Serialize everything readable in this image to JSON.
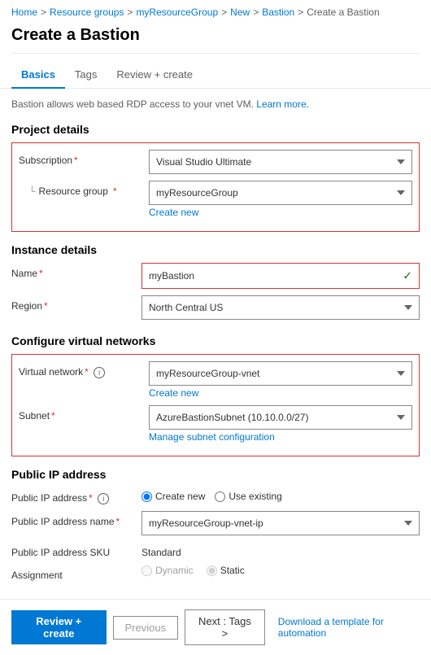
{
  "breadcrumb": {
    "items": [
      {
        "label": "Home",
        "link": true
      },
      {
        "label": "Resource groups",
        "link": true
      },
      {
        "label": "myResourceGroup",
        "link": true
      },
      {
        "label": "New",
        "link": true
      },
      {
        "label": "Bastion",
        "link": true
      },
      {
        "label": "Create a Bastion",
        "link": false
      }
    ],
    "separator": ">"
  },
  "page": {
    "title": "Create a Bastion"
  },
  "tabs": [
    {
      "label": "Basics",
      "active": true
    },
    {
      "label": "Tags",
      "active": false
    },
    {
      "label": "Review + create",
      "active": false
    }
  ],
  "info_text": "Bastion allows web based RDP access to your vnet VM.",
  "learn_more": "Learn more.",
  "sections": {
    "project_details": {
      "title": "Project details",
      "subscription": {
        "label": "Subscription",
        "required": true,
        "value": "Visual Studio Ultimate"
      },
      "resource_group": {
        "label": "Resource group",
        "required": true,
        "value": "myResourceGroup",
        "create_new": "Create new"
      }
    },
    "instance_details": {
      "title": "Instance details",
      "name": {
        "label": "Name",
        "required": true,
        "value": "myBastion",
        "valid": true
      },
      "region": {
        "label": "Region",
        "required": true,
        "value": "North Central US"
      }
    },
    "virtual_networks": {
      "title": "Configure virtual networks",
      "virtual_network": {
        "label": "Virtual network",
        "required": true,
        "has_info": true,
        "value": "myResourceGroup-vnet",
        "create_new": "Create new"
      },
      "subnet": {
        "label": "Subnet",
        "required": true,
        "value": "AzureBastionSubnet (10.10.0.0/27)",
        "manage_link": "Manage subnet configuration"
      }
    },
    "public_ip": {
      "title": "Public IP address",
      "ip_address": {
        "label": "Public IP address",
        "required": true,
        "has_info": true,
        "options": [
          "Create new",
          "Use existing"
        ],
        "selected": "Create new"
      },
      "ip_name": {
        "label": "Public IP address name",
        "required": true,
        "value": "myResourceGroup-vnet-ip"
      },
      "ip_sku": {
        "label": "Public IP address SKU",
        "value": "Standard"
      },
      "assignment": {
        "label": "Assignment",
        "options": [
          "Dynamic",
          "Static"
        ],
        "selected": "Static",
        "disabled": true
      }
    }
  },
  "footer": {
    "review_button": "Review + create",
    "previous_button": "Previous",
    "next_button": "Next : Tags >",
    "download_link": "Download a template for automation"
  }
}
